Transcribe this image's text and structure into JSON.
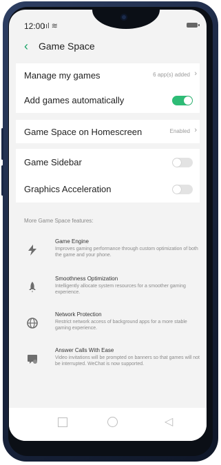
{
  "status_bar": {
    "time": "12:00",
    "signal": "ııl ≋"
  },
  "header": {
    "back_glyph": "‹",
    "title": "Game Space"
  },
  "settings": {
    "manage_games": {
      "label": "Manage my games",
      "value": "6 app(s) added"
    },
    "add_games_auto": {
      "label": "Add games automatically",
      "enabled": true
    },
    "homescreen": {
      "label": "Game Space on Homescreen",
      "value": "Enabled"
    },
    "sidebar": {
      "label": "Game Sidebar",
      "enabled": false
    },
    "graphics": {
      "label": "Graphics Acceleration",
      "enabled": false
    }
  },
  "features_section": {
    "title": "More Game Space features:",
    "items": [
      {
        "icon": "lightning-icon",
        "title": "Game Engine",
        "desc": "Improves gaming performance through custom optimization of both the game and your phone."
      },
      {
        "icon": "rocket-icon",
        "title": "Smoothness Optimization",
        "desc": "Intelligently allocate system resources for a smoother gaming experience."
      },
      {
        "icon": "globe-icon",
        "title": "Network Protection",
        "desc": "Restrict network access of background apps for a more stable gaming experience."
      },
      {
        "icon": "phone-bubble-icon",
        "title": "Answer Calls With Ease",
        "desc": "Video invitations will be prompted on banners so that games will not be interrupted. WeChat is now supported."
      }
    ]
  },
  "colors": {
    "accent": "#1aa468",
    "toggle_on": "#2ebc76",
    "toggle_off": "#e3e3e3",
    "background": "#f3f3f3"
  }
}
